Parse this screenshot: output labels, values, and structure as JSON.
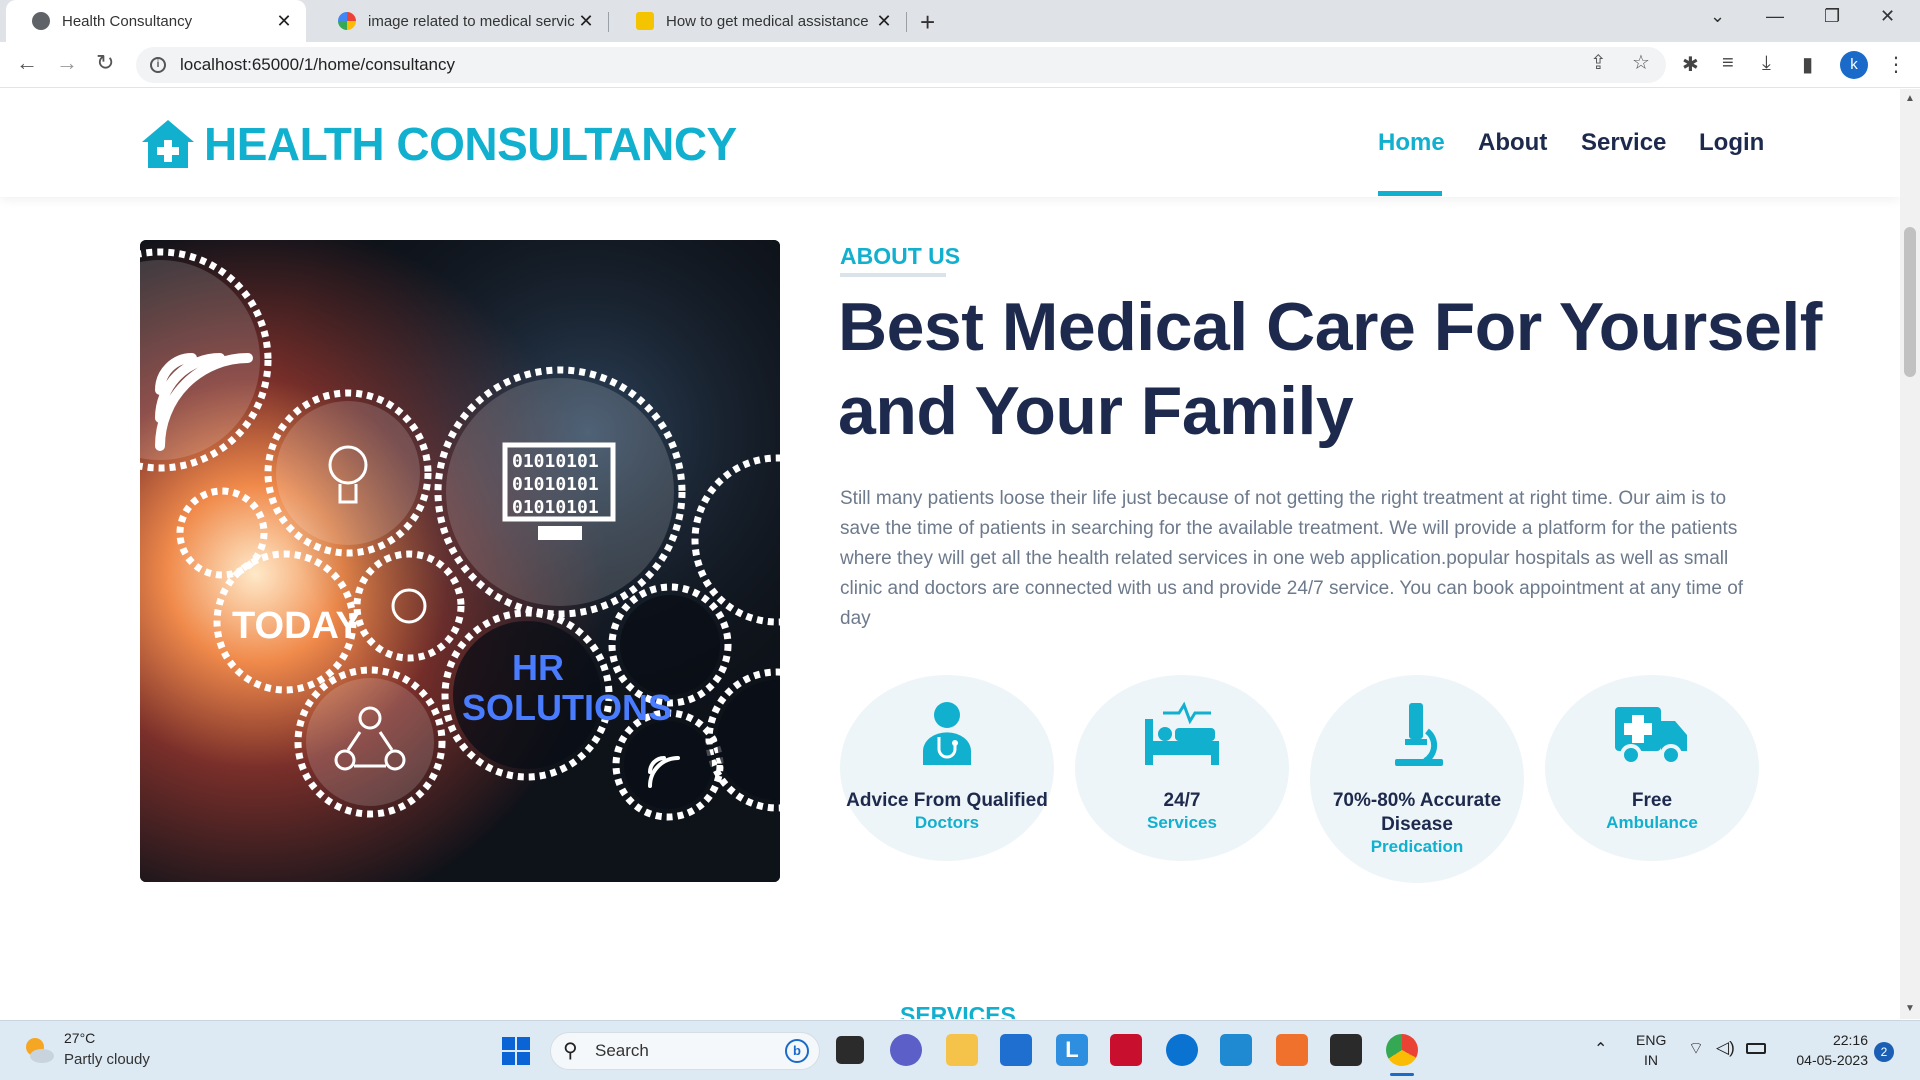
{
  "browser": {
    "tabs": [
      {
        "title": "Health Consultancy"
      },
      {
        "title": "image related to medical services"
      },
      {
        "title": "How to get medical assistance in"
      }
    ],
    "url": "localhost:65000/1/home/consultancy",
    "profile_initial": "k"
  },
  "site": {
    "brand": "HEALTH CONSULTANCY",
    "nav": [
      "Home",
      "About",
      "Service",
      "Login"
    ],
    "active_nav": "Home"
  },
  "about": {
    "eyebrow": "ABOUT US",
    "headline_line1": "Best Medical Care For Yourself",
    "headline_line2": "and Your Family",
    "description": "Still many patients loose their life just because of not getting the right treatment at right time. Our aim is to save the time of patients in searching for the available treatment. We will provide a platform for the patients where they will get all the health related services in one web application.popular hospitals as well as small clinic and doctors are connected with us and provide 24/7 service. You can book appointment at any time of day",
    "features": [
      {
        "icon": "doctor-icon",
        "title": "Advice From Qualified",
        "subtitle": "Doctors"
      },
      {
        "icon": "bed-icon",
        "title": "24/7",
        "subtitle": "Services"
      },
      {
        "icon": "microscope-icon",
        "title": "70%-80% Accurate Disease",
        "subtitle": "Predication"
      },
      {
        "icon": "ambulance-icon",
        "title": "Free",
        "subtitle": "Ambulance"
      }
    ]
  },
  "image_overlay_text": {
    "today": "TODAY",
    "hr": "HR",
    "solutions": "SOLUTIONS",
    "binary": "01010101"
  },
  "next_section": "SERVICES",
  "taskbar": {
    "temperature": "27°C",
    "condition": "Partly cloudy",
    "search_label": "Search",
    "lang_line1": "ENG",
    "lang_line2": "IN",
    "time": "22:16",
    "date": "04-05-2023",
    "notifications": "2"
  },
  "colors": {
    "accent": "#12b0cf",
    "heading": "#1d2a4d",
    "body_text": "#6d7a8c",
    "feature_bg": "#eef5f8"
  }
}
